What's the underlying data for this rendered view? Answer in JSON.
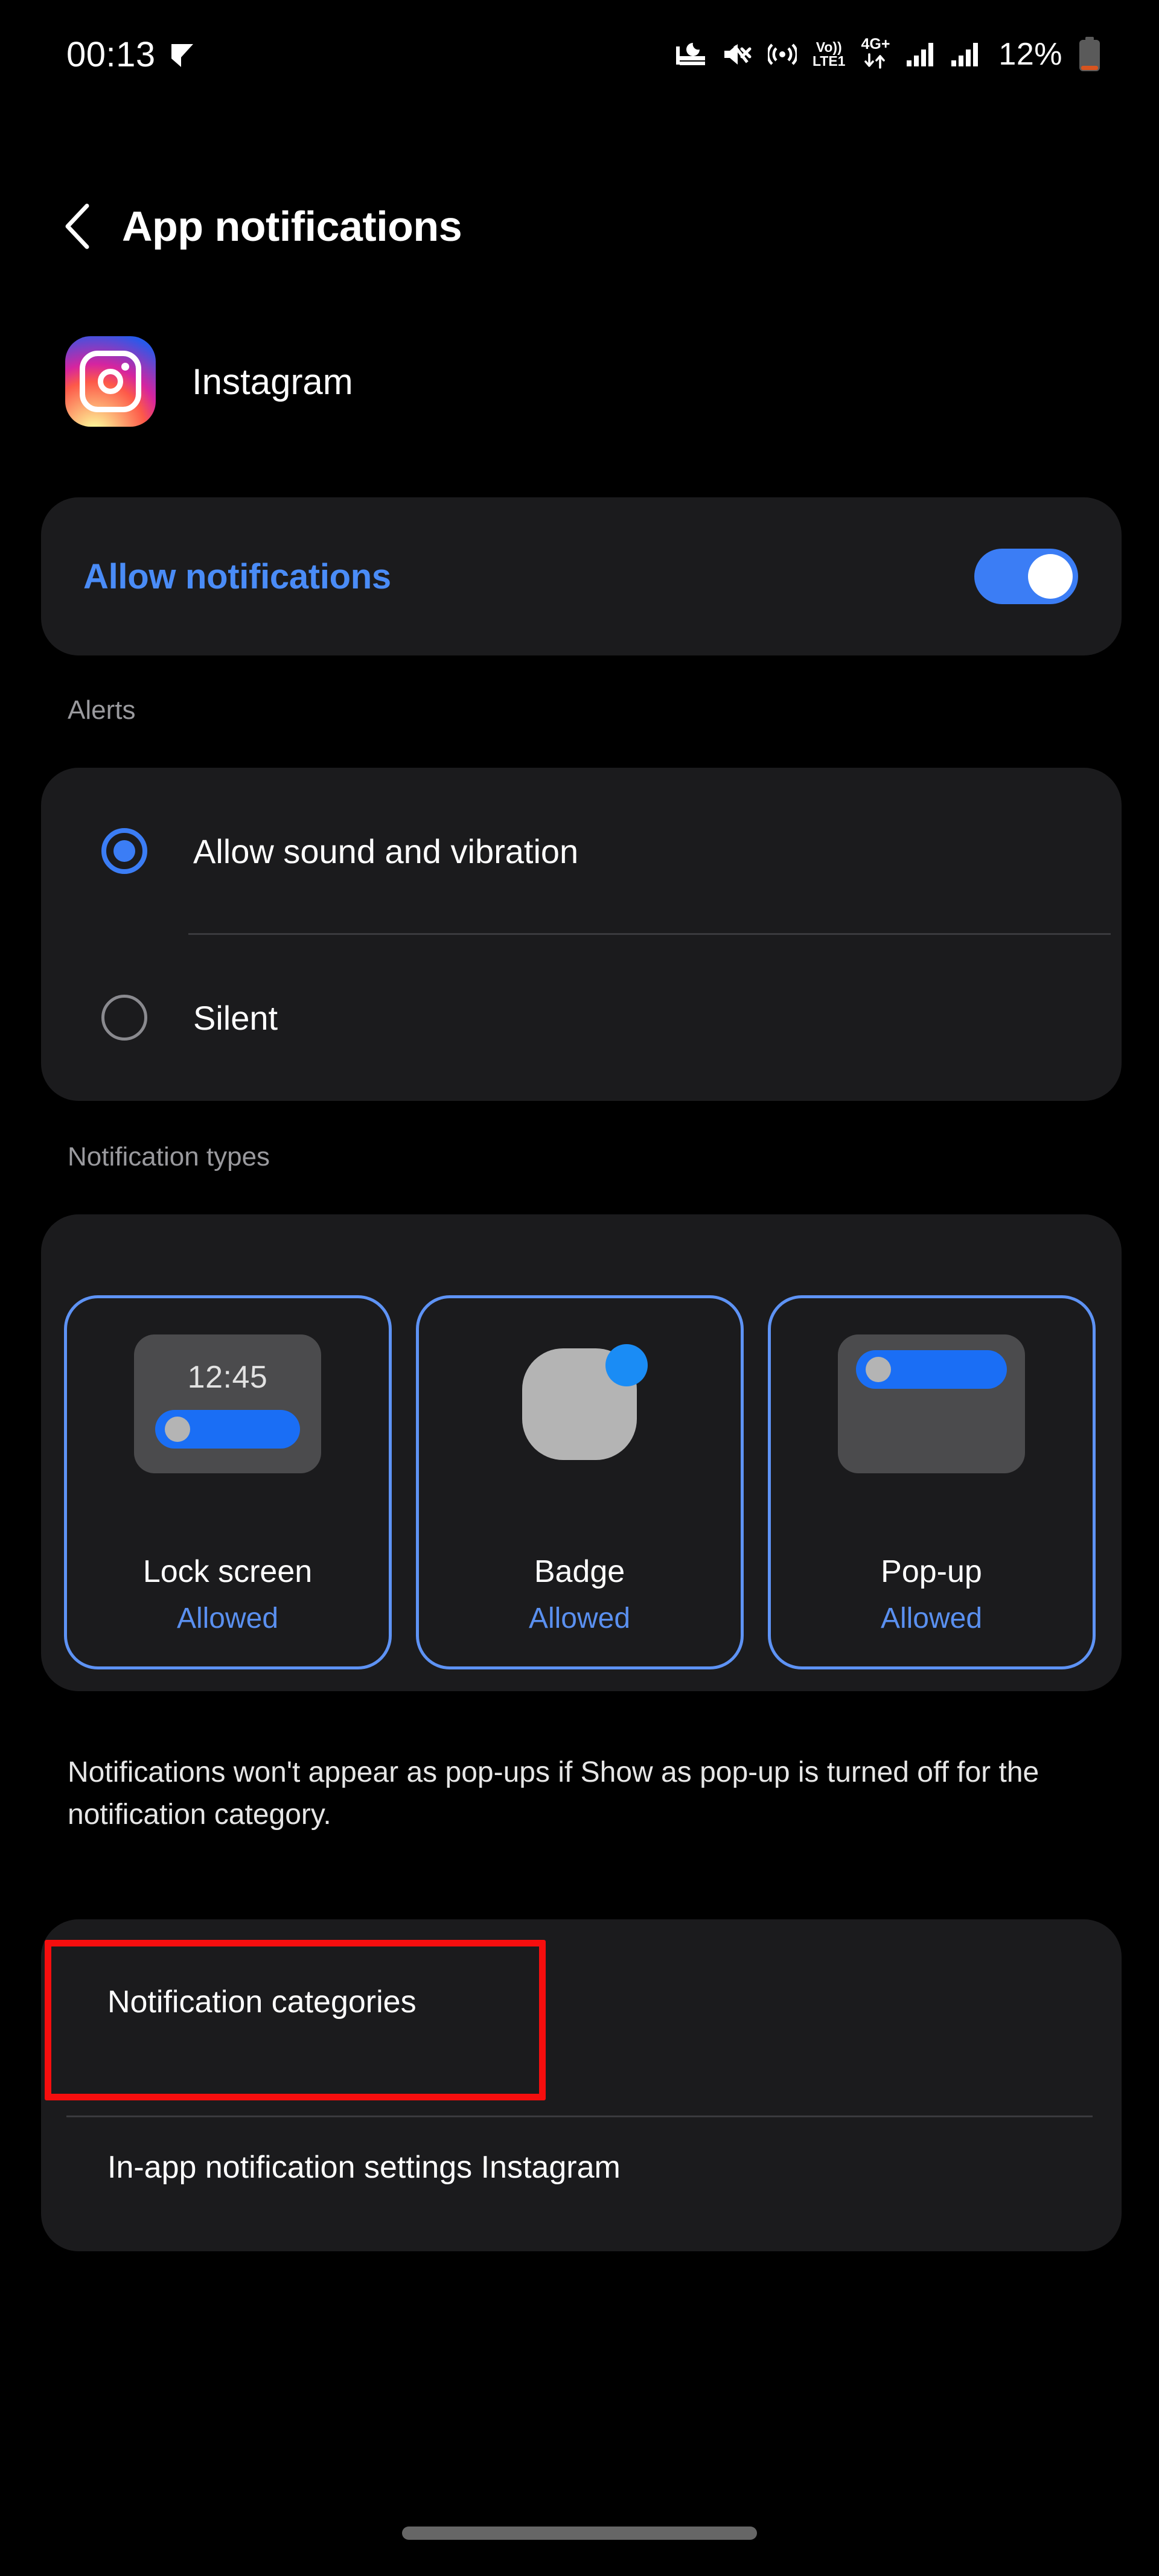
{
  "status_bar": {
    "time": "00:13",
    "left_icons": [
      "call-forward-check-icon"
    ],
    "right_icons": [
      "bedtime-mode-icon",
      "sound-muted-icon",
      "hotspot-icon",
      "volte-lte1-icon",
      "4g-plus-data-icon",
      "signal-bars-sim1-icon",
      "signal-bars-sim2-icon"
    ],
    "volte_top": "Vo))",
    "volte_bottom": "LTE1",
    "network_top": "4G+",
    "battery_percent": "12%"
  },
  "header": {
    "back_label": "Back",
    "title": "App notifications"
  },
  "app": {
    "name": "Instagram",
    "icon": "instagram-icon"
  },
  "allow": {
    "label": "Allow notifications",
    "enabled": true,
    "accent": "#4a8cf7"
  },
  "alerts": {
    "section_label": "Alerts",
    "options": [
      {
        "label": "Allow sound and vibration",
        "selected": true
      },
      {
        "label": "Silent",
        "selected": false
      }
    ]
  },
  "notification_types": {
    "section_label": "Notification types",
    "cards": [
      {
        "label": "Lock screen",
        "status": "Allowed",
        "preview": "lock-screen-preview",
        "preview_time": "12:45"
      },
      {
        "label": "Badge",
        "status": "Allowed",
        "preview": "badge-preview"
      },
      {
        "label": "Pop-up",
        "status": "Allowed",
        "preview": "popup-preview"
      }
    ],
    "selected_border_color": "#5e93f5",
    "status_color": "#5a90f0"
  },
  "hint": {
    "text": "Notifications won't appear as pop-ups if Show as pop-up is turned off for the notification category."
  },
  "bottom_list": {
    "rows": [
      {
        "label": "Notification categories",
        "highlighted": true
      },
      {
        "label": "In-app notification settings Instagram",
        "highlighted": false
      }
    ]
  },
  "annotation": {
    "color": "#f60e0e",
    "target": "Notification categories"
  }
}
